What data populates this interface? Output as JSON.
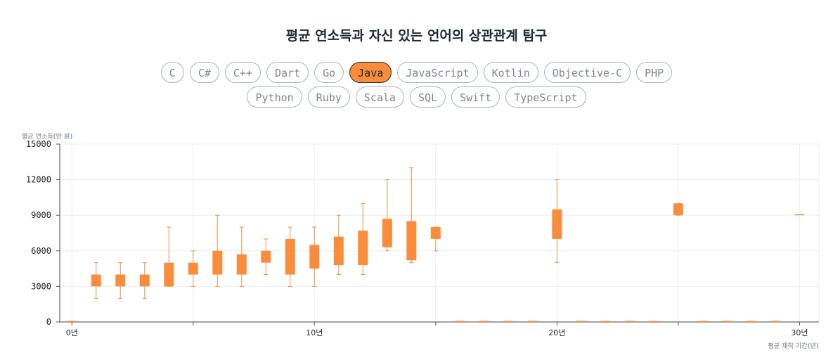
{
  "title": "평균 연소득과 자신 있는 언어의 상관관계 탐구",
  "languages_row1": [
    "C",
    "C#",
    "C++",
    "Dart",
    "Go",
    "Java",
    "JavaScript",
    "Kotlin",
    "Objective-C",
    "PHP"
  ],
  "languages_row2": [
    "Python",
    "Ruby",
    "Scala",
    "SQL",
    "Swift",
    "TypeScript"
  ],
  "selected_language": "Java",
  "colors": {
    "accent": "#fb8c3c",
    "whisker": "#e8924a",
    "grid": "#eeeeee",
    "chip_border": "#aab2bd",
    "chip_text": "#7a8594"
  },
  "chart_data": {
    "type": "candlestick",
    "ylabel": "평균 연소득(만 원)",
    "xlabel": "평균 재직 기간(년)",
    "ylim": [
      0,
      15000
    ],
    "yticks": [
      0,
      3000,
      6000,
      9000,
      12000,
      15000
    ],
    "xlim": [
      -0.5,
      30.8
    ],
    "xticks": [
      {
        "value": 0,
        "label": "0년"
      },
      {
        "value": 10,
        "label": "10년"
      },
      {
        "value": 20,
        "label": "20년"
      },
      {
        "value": 30,
        "label": "30년"
      }
    ],
    "grid": true,
    "points": [
      {
        "x": 0,
        "low": 0,
        "q1": 0,
        "q3": 0,
        "high": 0
      },
      {
        "x": 1,
        "low": 2000,
        "q1": 3000,
        "q3": 4000,
        "high": 5000
      },
      {
        "x": 2,
        "low": 2000,
        "q1": 3000,
        "q3": 4000,
        "high": 5000
      },
      {
        "x": 3,
        "low": 2000,
        "q1": 3000,
        "q3": 4000,
        "high": 5000
      },
      {
        "x": 4,
        "low": 3000,
        "q1": 3000,
        "q3": 5000,
        "high": 8000
      },
      {
        "x": 5,
        "low": 3000,
        "q1": 4000,
        "q3": 5000,
        "high": 6000
      },
      {
        "x": 6,
        "low": 3000,
        "q1": 4000,
        "q3": 6000,
        "high": 9000
      },
      {
        "x": 7,
        "low": 3000,
        "q1": 4000,
        "q3": 5700,
        "high": 8000
      },
      {
        "x": 8,
        "low": 4000,
        "q1": 5000,
        "q3": 6000,
        "high": 7000
      },
      {
        "x": 9,
        "low": 3000,
        "q1": 4000,
        "q3": 7000,
        "high": 8000
      },
      {
        "x": 10,
        "low": 3000,
        "q1": 4500,
        "q3": 6500,
        "high": 8000
      },
      {
        "x": 11,
        "low": 4000,
        "q1": 4800,
        "q3": 7200,
        "high": 9000
      },
      {
        "x": 12,
        "low": 4000,
        "q1": 4800,
        "q3": 7700,
        "high": 10000
      },
      {
        "x": 13,
        "low": 6000,
        "q1": 6300,
        "q3": 8700,
        "high": 12000
      },
      {
        "x": 14,
        "low": 5000,
        "q1": 5200,
        "q3": 8500,
        "high": 13000
      },
      {
        "x": 15,
        "low": 6000,
        "q1": 7000,
        "q3": 8000,
        "high": 8000
      },
      {
        "x": 16,
        "low": 0,
        "q1": 0,
        "q3": 0,
        "high": 0
      },
      {
        "x": 17,
        "low": 0,
        "q1": 0,
        "q3": 0,
        "high": 0
      },
      {
        "x": 18,
        "low": 0,
        "q1": 0,
        "q3": 0,
        "high": 0
      },
      {
        "x": 19,
        "low": 0,
        "q1": 0,
        "q3": 0,
        "high": 0
      },
      {
        "x": 20,
        "low": 5000,
        "q1": 7000,
        "q3": 9500,
        "high": 12000
      },
      {
        "x": 21,
        "low": 0,
        "q1": 0,
        "q3": 0,
        "high": 0
      },
      {
        "x": 22,
        "low": 0,
        "q1": 0,
        "q3": 0,
        "high": 0
      },
      {
        "x": 23,
        "low": 0,
        "q1": 0,
        "q3": 0,
        "high": 0
      },
      {
        "x": 24,
        "low": 0,
        "q1": 0,
        "q3": 0,
        "high": 0
      },
      {
        "x": 25,
        "low": 9000,
        "q1": 9000,
        "q3": 10000,
        "high": 10000
      },
      {
        "x": 26,
        "low": 0,
        "q1": 0,
        "q3": 0,
        "high": 0
      },
      {
        "x": 27,
        "low": 0,
        "q1": 0,
        "q3": 0,
        "high": 0
      },
      {
        "x": 28,
        "low": 0,
        "q1": 0,
        "q3": 0,
        "high": 0
      },
      {
        "x": 29,
        "low": 0,
        "q1": 0,
        "q3": 0,
        "high": 0
      },
      {
        "x": 30,
        "low": 9000,
        "q1": 9000,
        "q3": 9000,
        "high": 9000
      }
    ]
  }
}
